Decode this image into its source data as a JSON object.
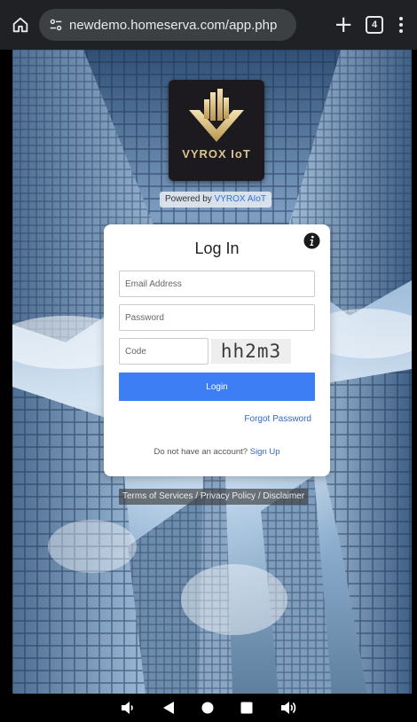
{
  "browser": {
    "url": "newdemo.homeserva.com/app.php",
    "tab_count": "4"
  },
  "logo": {
    "text": "VYROX IoT",
    "powered_prefix": "Powered by ",
    "powered_brand": "VYROX AIoT"
  },
  "login": {
    "title": "Log In",
    "email_placeholder": "Email Address",
    "password_placeholder": "Password",
    "code_placeholder": "Code",
    "captcha": "hh2m3",
    "button_label": "Login",
    "forgot_label": "Forgot Password",
    "signup_prompt": "Do not have an account? ",
    "signup_link": "Sign Up"
  },
  "footer": {
    "terms": "Terms of Services",
    "sep1": " / ",
    "privacy": "Privacy Policy",
    "sep2": " / ",
    "disclaimer": "Disclaimer"
  },
  "colors": {
    "accent": "#3d7ef5",
    "link": "#3268c8",
    "logo_gold": "#d9c48f"
  },
  "icons": [
    "home-icon",
    "site-settings-icon",
    "plus-icon",
    "tab-switcher-icon",
    "more-icon",
    "info-icon",
    "volume-down-icon",
    "back-icon",
    "home-nav-icon",
    "recents-icon",
    "volume-up-icon"
  ]
}
